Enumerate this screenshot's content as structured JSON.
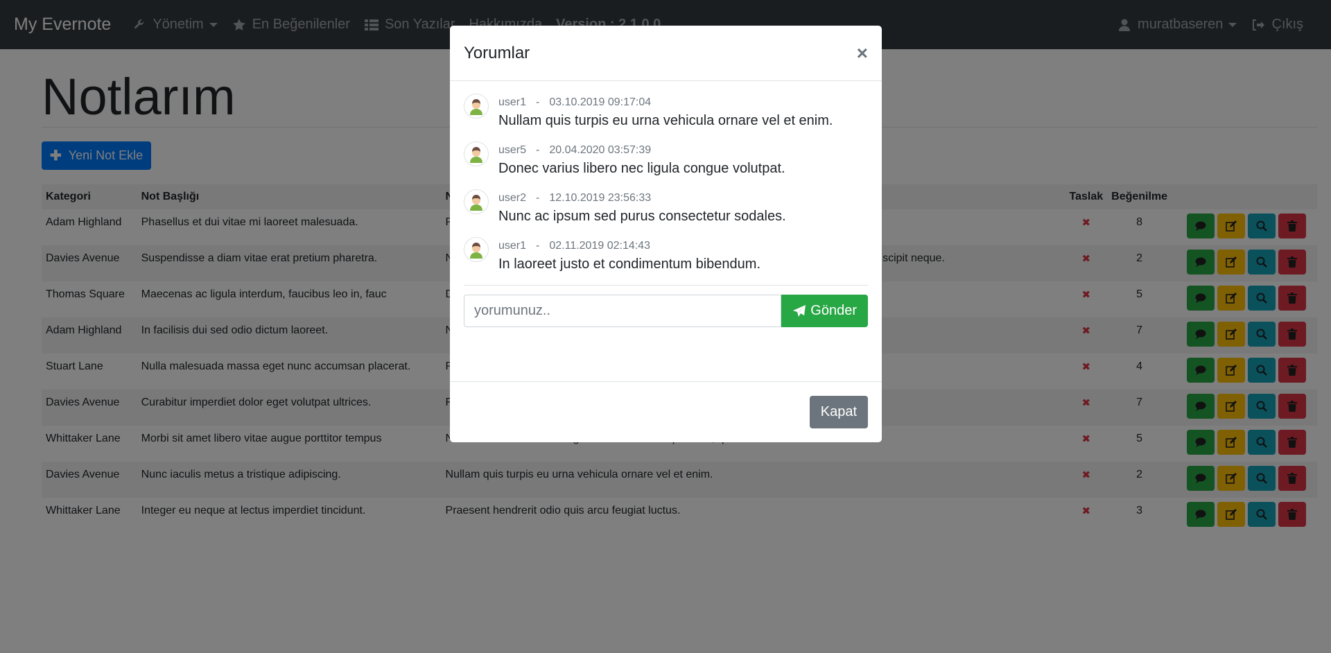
{
  "navbar": {
    "brand": "My Evernote",
    "items": [
      {
        "label": "Yönetim"
      },
      {
        "label": "En Beğenilenler"
      },
      {
        "label": "Son Yazılar"
      },
      {
        "label": "Hakkımızda"
      },
      {
        "label": "Version : 2.1.0.0"
      }
    ],
    "user": "muratbaseren",
    "logout": "Çıkış"
  },
  "page": {
    "title": "Notlarım",
    "new_button": "Yeni Not Ekle"
  },
  "table": {
    "headers": {
      "category": "Kategori",
      "title": "Not Başlığı",
      "text": "Not",
      "draft": "Taslak",
      "likes": "Beğenilme"
    },
    "rows": [
      {
        "category": "Adam Highland",
        "title": "Phasellus et dui vitae mi laoreet malesuada.",
        "text": "Phasellus et dui vitae mi laoreet malesuada.",
        "likes": "8"
      },
      {
        "category": "Davies Avenue",
        "title": "Suspendisse a diam vitae erat pretium pharetra.",
        "text": "Nullam quis turpis eu urna vehicula ornare vel et enim. Suspendisse a diam vitae erat, suscipit neque.",
        "likes": "2"
      },
      {
        "category": "Thomas Square",
        "title": "Maecenas ac ligula interdum, faucibus leo in, fauc",
        "text": "Donec varius libero nec ligula congue volutpat.",
        "likes": "5"
      },
      {
        "category": "Adam Highland",
        "title": "In facilisis dui sed odio dictum laoreet.",
        "text": "Nunc ac ipsum sed purus consectetur sodales, suscipit sagittis.",
        "likes": "7"
      },
      {
        "category": "Stuart Lane",
        "title": "Nulla malesuada massa eget nunc accumsan placerat.",
        "text": "Praesent hendrerit odio quis arcu feugiat luctus.",
        "likes": "4"
      },
      {
        "category": "Davies Avenue",
        "title": "Curabitur imperdiet dolor eget volutpat ultrices.",
        "text": "Fusce imperdiet dolor eget volutpat ultrices.",
        "likes": "7"
      },
      {
        "category": "Whittaker Lane",
        "title": "Morbi sit amet libero vitae augue porttitor tempus",
        "text": "Nulla malesuada massa eget nunc accumsan placerat, quis eleifend eleifend.",
        "likes": "5"
      },
      {
        "category": "Davies Avenue",
        "title": "Nunc iaculis metus a tristique adipiscing.",
        "text": "Nullam quis turpis eu urna vehicula ornare vel et enim.",
        "likes": "2"
      },
      {
        "category": "Whittaker Lane",
        "title": "Integer eu neque at lectus imperdiet tincidunt.",
        "text": "Praesent hendrerit odio quis arcu feugiat luctus.",
        "likes": "3"
      }
    ]
  },
  "modal": {
    "title": "Yorumlar",
    "close_symbol": "×",
    "comments": [
      {
        "user": "user1",
        "date": "03.10.2019 09:17:04",
        "text": "Nullam quis turpis eu urna vehicula ornare vel et enim."
      },
      {
        "user": "user5",
        "date": "20.04.2020 03:57:39",
        "text": "Donec varius libero nec ligula congue volutpat."
      },
      {
        "user": "user2",
        "date": "12.10.2019 23:56:33",
        "text": "Nunc ac ipsum sed purus consectetur sodales."
      },
      {
        "user": "user1",
        "date": "02.11.2019 02:14:43",
        "text": "In laoreet justo et condimentum bibendum."
      }
    ],
    "separator": "-",
    "input_placeholder": "yorumunuz..",
    "send_label": "Gönder",
    "close_label": "Kapat"
  },
  "colors": {
    "navbar": "#343a40",
    "primary": "#007bff",
    "success": "#28a745",
    "warning": "#ffc107",
    "info": "#17a2b8",
    "danger": "#dc3545",
    "secondary": "#6c757d"
  }
}
